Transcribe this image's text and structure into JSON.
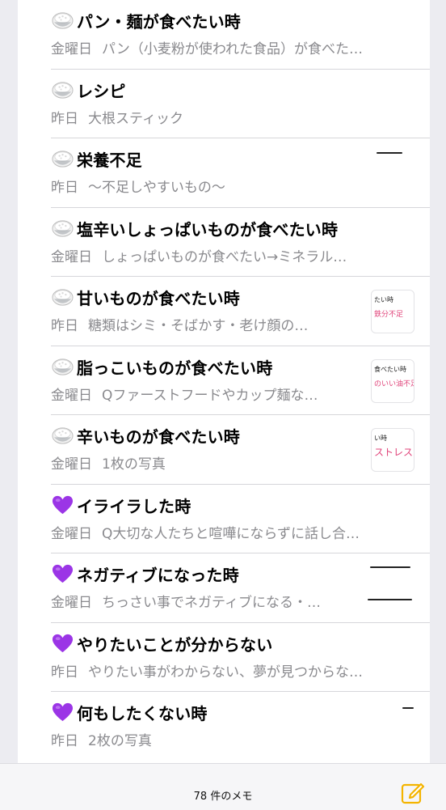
{
  "notes": [
    {
      "icon": "rice-bowl-icon",
      "title": "パン・麺が食べたい時",
      "date": "金曜日",
      "preview": "パン（小麦粉が使われた食品）が食べた…"
    },
    {
      "icon": "rice-bowl-icon",
      "title": "レシピ",
      "date": "昨日",
      "preview": "大根スティック"
    },
    {
      "icon": "rice-bowl-icon",
      "title": "栄養不足",
      "date": "昨日",
      "preview": "〜不足しやすいもの〜"
    },
    {
      "icon": "rice-bowl-icon",
      "title": "塩辛いしょっぱいものが食べたい時",
      "date": "金曜日",
      "preview": "しょっぱいものが食べたい→ミネラル…"
    },
    {
      "icon": "rice-bowl-icon",
      "title": "甘いものが食べたい時",
      "date": "昨日",
      "preview": "糖類はシミ・そばかす・老け顔の…",
      "thumb": {
        "line1": "たい時",
        "line2": "鉄分不足"
      }
    },
    {
      "icon": "rice-bowl-icon",
      "title": "脂っこいものが食べたい時",
      "date": "金曜日",
      "preview": "Qファーストフードやカップ麺な…",
      "thumb": {
        "line1": "食べたい時",
        "line2": "のいい油不足"
      }
    },
    {
      "icon": "rice-bowl-icon",
      "title": "辛いものが食べたい時",
      "date": "金曜日",
      "preview": "1枚の写真",
      "thumb": {
        "line1": "い時",
        "line2": "ストレスか"
      }
    },
    {
      "icon": "purple-heart-icon",
      "title": "イライラした時",
      "date": "金曜日",
      "preview": "Q大切な人たちと喧嘩にならずに話し合…"
    },
    {
      "icon": "purple-heart-icon",
      "title": "ネガティブになった時",
      "date": "金曜日",
      "preview": "ちっさい事でネガティブになる・…"
    },
    {
      "icon": "purple-heart-icon",
      "title": "やりたいことが分からない",
      "date": "昨日",
      "preview": "やりたい事がわからない、夢が見つからな…"
    },
    {
      "icon": "purple-heart-icon",
      "title": "何もしたくない時",
      "date": "昨日",
      "preview": "2枚の写真"
    }
  ],
  "footer": {
    "count_label": "78 件のメモ"
  },
  "colors": {
    "accent": "#f4b400",
    "heart": "#9b35e6",
    "secondary_text": "#8a8a8e"
  }
}
